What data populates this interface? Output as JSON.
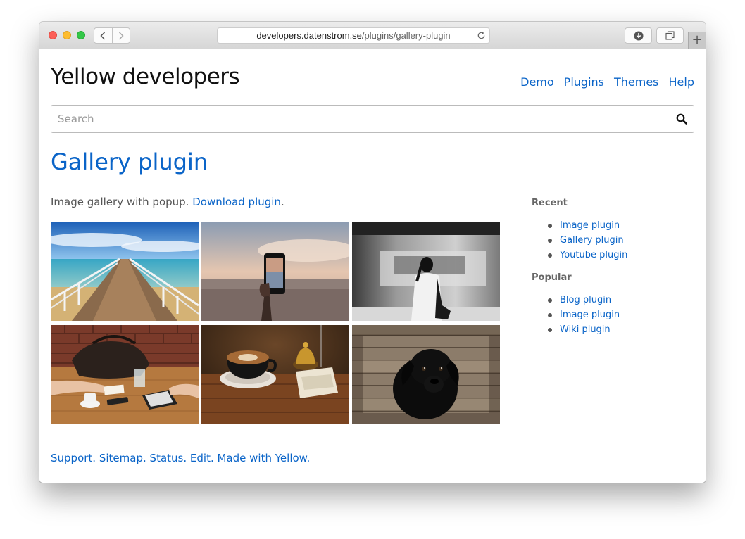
{
  "browser": {
    "url_host": "developers.datenstrom.se",
    "url_path": "/plugins/gallery-plugin",
    "new_tab_label": "+"
  },
  "header": {
    "site_title": "Yellow developers",
    "nav": [
      "Demo",
      "Plugins",
      "Themes",
      "Help"
    ]
  },
  "search": {
    "placeholder": "Search",
    "value": ""
  },
  "main": {
    "title": "Gallery plugin",
    "intro_text": "Image gallery with popup. ",
    "intro_link": "Download plugin",
    "intro_end": ".",
    "images": [
      "pier-photo",
      "phone-sunset-photo",
      "subway-woman-photo",
      "table-laptop-photo",
      "coffee-photo",
      "black-dog-photo"
    ]
  },
  "sidebar": {
    "recent_heading": "Recent",
    "recent": [
      "Image plugin",
      "Gallery plugin",
      "Youtube plugin"
    ],
    "popular_heading": "Popular",
    "popular": [
      "Blog plugin",
      "Image plugin",
      "Wiki plugin"
    ]
  },
  "footer": {
    "links": [
      "Support.",
      "Sitemap.",
      "Status.",
      "Edit.",
      "Made with Yellow."
    ]
  },
  "colors": {
    "link": "#0a64c8",
    "title_text": "#111111",
    "body_text": "#555555"
  }
}
